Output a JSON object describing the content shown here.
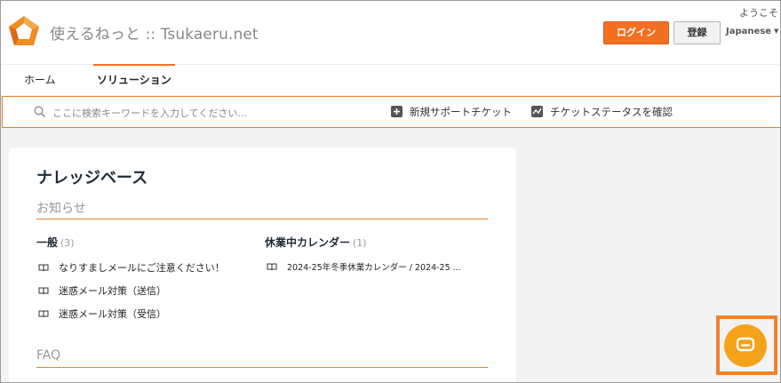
{
  "header": {
    "site_title": "使えるねっと :: Tsukaeru.net",
    "welcome": "ようこそ",
    "login_label": "ログイン",
    "register_label": "登録",
    "language": "Japanese"
  },
  "nav": {
    "tabs": [
      {
        "label": "ホーム",
        "active": false
      },
      {
        "label": "ソリューション",
        "active": true
      }
    ]
  },
  "search": {
    "placeholder": "ここに検索キーワードを入力してください...",
    "actions": [
      {
        "label": "新規サポートチケット",
        "icon": "plus-icon"
      },
      {
        "label": "チケットステータスを確認",
        "icon": "status-chart-icon"
      }
    ]
  },
  "knowledge_base": {
    "title": "ナレッジベース",
    "sections": [
      {
        "title": "お知らせ",
        "categories": [
          {
            "name": "一般",
            "count": "(3)",
            "articles": [
              "なりすましメールにご注意ください！",
              "迷惑メール対策（送信）",
              "迷惑メール対策（受信）"
            ]
          },
          {
            "name": "休業中カレンダー",
            "count": "(1)",
            "articles": [
              "2024-25年冬季休業カレンダー / 2024-25 ..."
            ]
          }
        ]
      },
      {
        "title": "FAQ",
        "categories": []
      }
    ]
  },
  "colors": {
    "accent": "#f37021",
    "chat": "#f4a21a",
    "heading": "#1f2a37"
  }
}
